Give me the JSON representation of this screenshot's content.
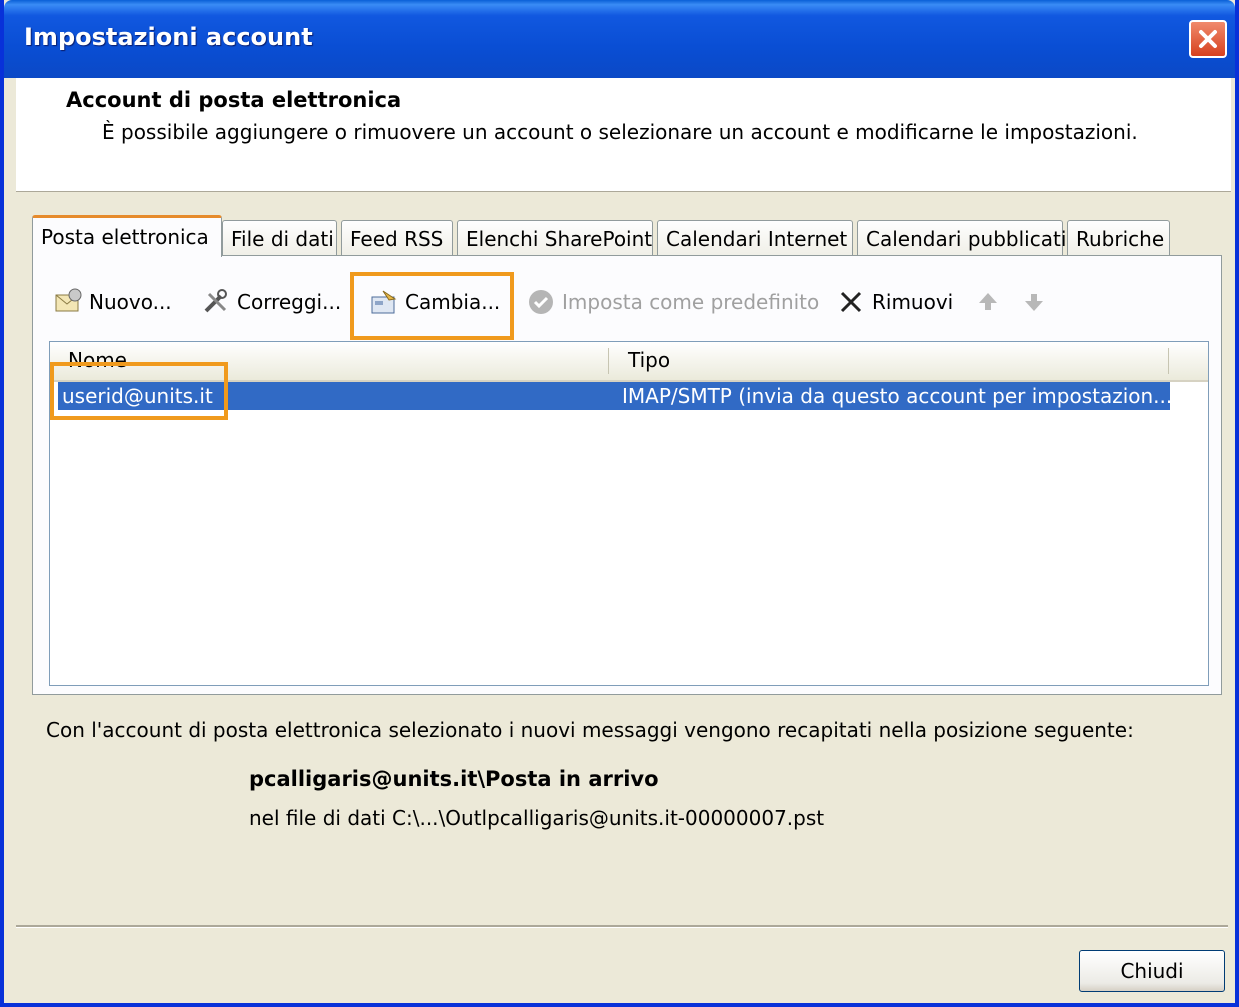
{
  "window": {
    "title": "Impostazioni account"
  },
  "header": {
    "title": "Account di posta elettronica",
    "subtitle": "È possibile aggiungere o rimuovere un account o selezionare un account e modificarne le impostazioni."
  },
  "tabs": [
    {
      "label": "Posta elettronica",
      "active": true
    },
    {
      "label": "File di dati"
    },
    {
      "label": "Feed RSS"
    },
    {
      "label": "Elenchi SharePoint"
    },
    {
      "label": "Calendari Internet"
    },
    {
      "label": "Calendari pubblicati"
    },
    {
      "label": "Rubriche"
    }
  ],
  "toolbar": {
    "new_label": "Nuovo...",
    "repair_label": "Correggi...",
    "change_label": "Cambia...",
    "default_label": "Imposta come predefinito",
    "remove_label": "Rimuovi"
  },
  "list": {
    "columns": [
      "Nome",
      "Tipo"
    ],
    "rows": [
      {
        "name": "userid@units.it",
        "type": "IMAP/SMTP (invia da questo account per impostazion..."
      }
    ]
  },
  "delivery": {
    "info": "Con l'account di posta elettronica selezionato i nuovi messaggi vengono recapitati nella posizione seguente:",
    "folder": "pcalligaris@units.it\\Posta in arrivo",
    "file": "nel file di dati C:\\...\\Outlpcalligaris@units.it-00000007.pst"
  },
  "footer": {
    "close_label": "Chiudi"
  },
  "colors": {
    "highlight": "#f09a1d",
    "selection": "#316ac5",
    "titlebar": "#0a4ed4"
  }
}
